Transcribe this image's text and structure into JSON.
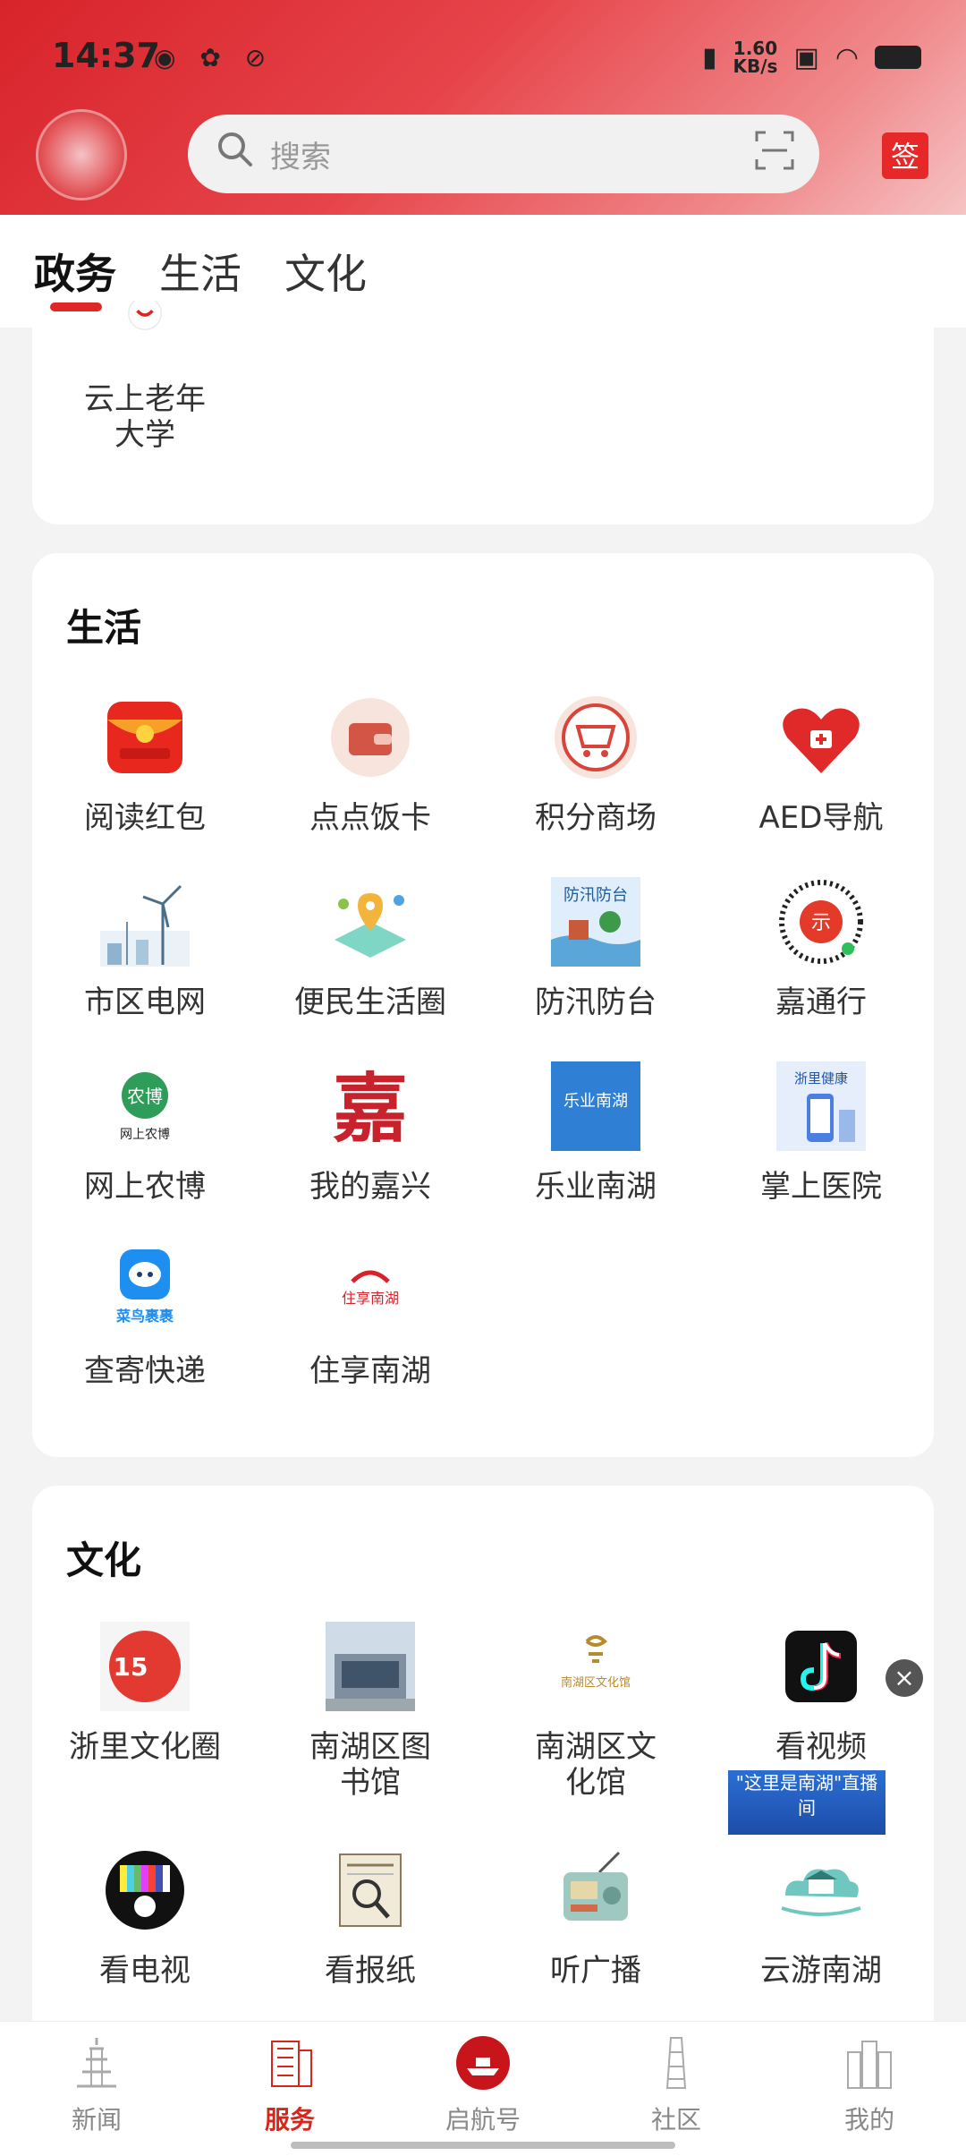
{
  "status_bar": {
    "time": "14:37",
    "network_speed_value": "1.60",
    "network_speed_unit": "KB/s"
  },
  "header": {
    "search_placeholder": "搜索",
    "sign_label": "签"
  },
  "tabs": [
    {
      "label": "政务",
      "active": true
    },
    {
      "label": "生活",
      "active": false
    },
    {
      "label": "文化",
      "active": false
    }
  ],
  "gov_section": {
    "item": {
      "line1": "云上老年",
      "line2": "大学",
      "icon": "elder-university-icon"
    }
  },
  "life_section": {
    "title": "生活",
    "items": [
      {
        "label": "阅读红包",
        "icon": "red-envelope-icon"
      },
      {
        "label": "点点饭卡",
        "icon": "wallet-icon"
      },
      {
        "label": "积分商场",
        "icon": "cart-icon"
      },
      {
        "label": "AED导航",
        "icon": "aed-heart-icon"
      },
      {
        "label": "市区电网",
        "icon": "wind-turbine-icon"
      },
      {
        "label": "便民生活圈",
        "icon": "map-pin-icon"
      },
      {
        "label": "防汛防台",
        "icon": "flood-icon",
        "text": "防汛防台"
      },
      {
        "label": "嘉通行",
        "icon": "qr-code-icon",
        "text": "示"
      },
      {
        "label": "网上农博",
        "icon": "agri-expo-icon",
        "text": "农博",
        "subtext": "网上农博"
      },
      {
        "label": "我的嘉兴",
        "icon": "jiaxing-icon",
        "text": "嘉"
      },
      {
        "label": "乐业南湖",
        "icon": "job-icon",
        "text": "乐业南湖"
      },
      {
        "label": "掌上医院",
        "icon": "hospital-icon",
        "text": "浙里健康"
      },
      {
        "label": "查寄快递",
        "icon": "cainiao-icon",
        "text": "菜鸟裹裹"
      },
      {
        "label": "住享南湖",
        "icon": "housing-icon",
        "text": "住享南湖"
      }
    ]
  },
  "culture_section": {
    "title": "文化",
    "items": [
      {
        "line1": "浙里文化圈",
        "line2": "",
        "icon": "culture-circle-icon",
        "text": "15"
      },
      {
        "line1": "南湖区图",
        "line2": "书馆",
        "icon": "library-icon"
      },
      {
        "line1": "南湖区文",
        "line2": "化馆",
        "icon": "culture-center-icon",
        "text": "南湖区文化馆"
      },
      {
        "line1": "看视频",
        "line2": "",
        "icon": "tiktok-icon"
      },
      {
        "line1": "看电视",
        "line2": "",
        "icon": "tv-icon"
      },
      {
        "line1": "看报纸",
        "line2": "",
        "icon": "newspaper-icon"
      },
      {
        "line1": "听广播",
        "line2": "",
        "icon": "radio-icon"
      },
      {
        "line1": "云游南湖",
        "line2": "",
        "icon": "cloud-tour-icon"
      }
    ],
    "ad_banner_text": "\"这里是南湖\"直播间",
    "close_glyph": "×"
  },
  "bottom_nav": [
    {
      "label": "新闻",
      "active": false,
      "icon": "pagoda-icon"
    },
    {
      "label": "服务",
      "active": true,
      "icon": "service-icon"
    },
    {
      "label": "启航号",
      "active": false,
      "icon": "boat-icon"
    },
    {
      "label": "社区",
      "active": false,
      "icon": "tower-icon"
    },
    {
      "label": "我的",
      "active": false,
      "icon": "building-icon"
    }
  ],
  "colors": {
    "accent": "#e02828",
    "header_gradient_start": "#d8232a"
  }
}
